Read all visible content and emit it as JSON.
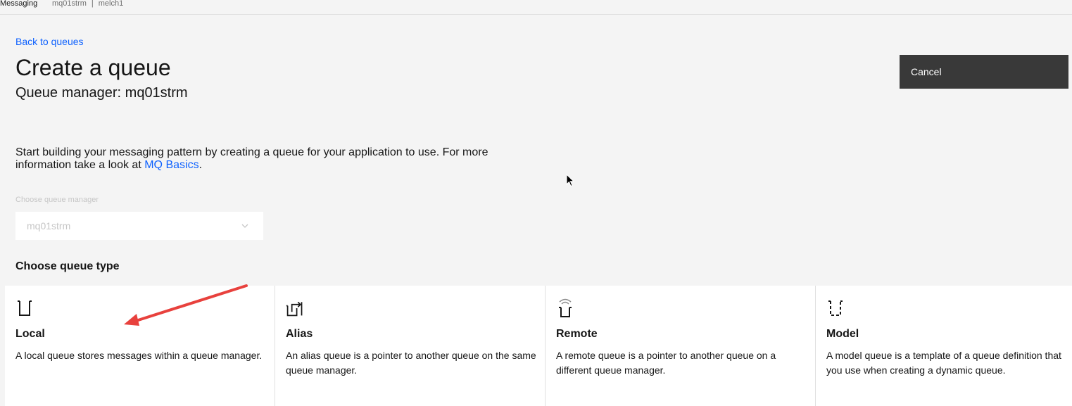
{
  "topbar": {
    "app_name": "Messaging",
    "crumb_1": "mq01strm",
    "separator": "|",
    "crumb_2": "melch1"
  },
  "header": {
    "back_link": "Back to queues",
    "title": "Create a queue",
    "subtitle": "Queue manager: mq01strm",
    "cancel_label": "Cancel"
  },
  "intro": {
    "text_before": "Start building your messaging pattern by creating a queue for your application to use. For more information take a look at ",
    "link": "MQ Basics",
    "text_after": "."
  },
  "queue_manager_select": {
    "label": "Choose queue manager",
    "value": "mq01strm"
  },
  "queue_type": {
    "title": "Choose queue type",
    "tiles": [
      {
        "name": "Local",
        "icon": "local-queue-icon",
        "description": "A local queue stores messages within a queue manager."
      },
      {
        "name": "Alias",
        "icon": "alias-queue-icon",
        "description": "An alias queue is a pointer to another queue on the same queue manager."
      },
      {
        "name": "Remote",
        "icon": "remote-queue-icon",
        "description": "A remote queue is a pointer to another queue on a different queue manager."
      },
      {
        "name": "Model",
        "icon": "model-queue-icon",
        "description": "A model queue is a template of a queue definition that you use when creating a dynamic queue."
      }
    ]
  },
  "annotation": {
    "arrow_color": "#e8413d"
  }
}
